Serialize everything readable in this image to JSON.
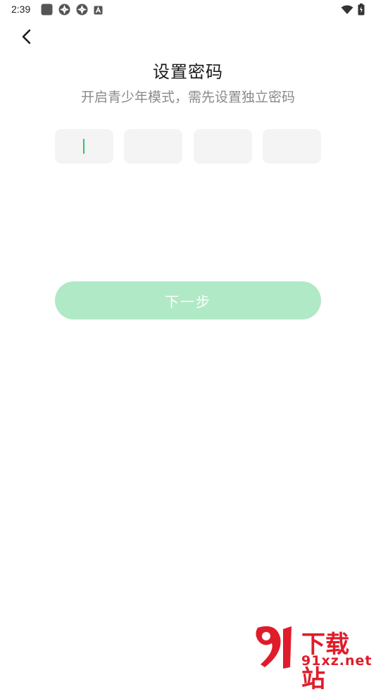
{
  "status_bar": {
    "time": "2:39",
    "left_icons": [
      "square-notification-icon",
      "aperture-icon",
      "aperture-icon",
      "a-box-icon"
    ],
    "right_icons": [
      "wifi-icon",
      "battery-charging-icon"
    ]
  },
  "header": {
    "back_icon": "chevron-left-icon"
  },
  "main": {
    "title": "设置密码",
    "subtitle": "开启青少年模式，需先设置独立密码",
    "pin_boxes": [
      "",
      "",
      "",
      ""
    ],
    "next_label": "下一步"
  },
  "watermark": {
    "cn": "下载站",
    "en": "91xz.net",
    "logo_text": "91"
  },
  "colors": {
    "accent": "#2cc56b",
    "button_disabled": "#b0e9c6",
    "pin_box_bg": "#f4f4f4",
    "subtitle": "#8a8a8a",
    "watermark_red": "#e01c2a"
  }
}
